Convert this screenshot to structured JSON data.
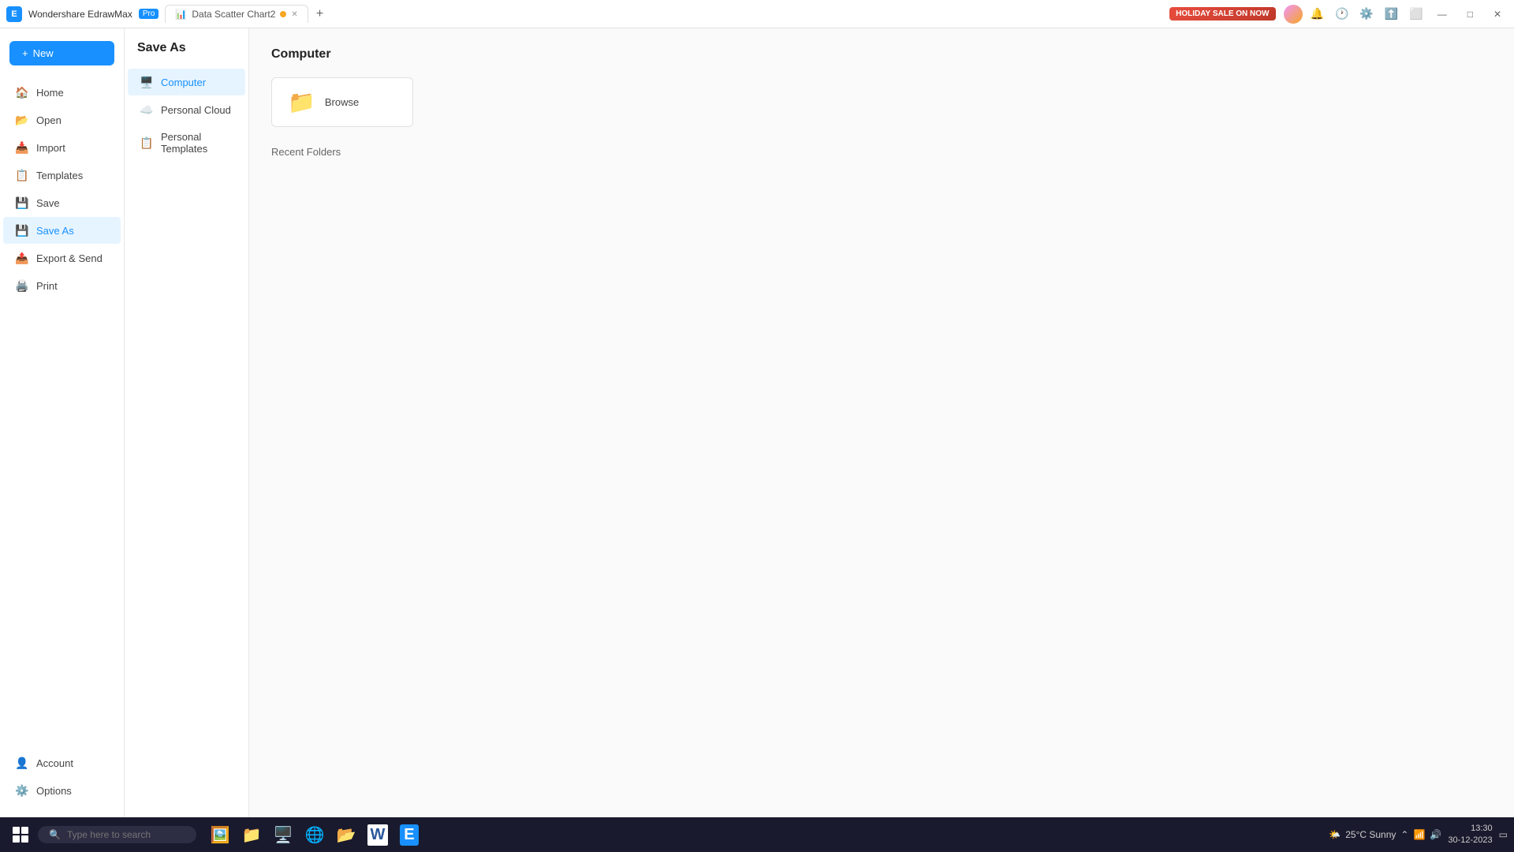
{
  "titlebar": {
    "app_name": "Wondershare EdrawMax",
    "pro_badge": "Pro",
    "tabs": [
      {
        "label": "Data Scatter Chart2",
        "active": false,
        "has_dot": true
      },
      {
        "label": "",
        "active": false
      }
    ],
    "holiday_btn": "HOLIDAY SALE ON NOW",
    "window_controls": {
      "minimize": "—",
      "maximize": "□",
      "close": "✕"
    }
  },
  "sidebar": {
    "new_btn": "New",
    "items": [
      {
        "id": "home",
        "label": "Home",
        "icon": "🏠"
      },
      {
        "id": "open",
        "label": "Open",
        "icon": "📂"
      },
      {
        "id": "import",
        "label": "Import",
        "icon": "📥"
      },
      {
        "id": "templates",
        "label": "Templates",
        "icon": "📋"
      },
      {
        "id": "save",
        "label": "Save",
        "icon": "💾"
      },
      {
        "id": "save-as",
        "label": "Save As",
        "icon": "💾",
        "active": true
      },
      {
        "id": "export-send",
        "label": "Export & Send",
        "icon": "📤"
      },
      {
        "id": "print",
        "label": "Print",
        "icon": "🖨️"
      }
    ],
    "bottom_items": [
      {
        "id": "account",
        "label": "Account",
        "icon": "👤"
      },
      {
        "id": "options",
        "label": "Options",
        "icon": "⚙️"
      }
    ]
  },
  "saveas_panel": {
    "title": "Save As",
    "items": [
      {
        "id": "computer",
        "label": "Computer",
        "icon": "🖥️",
        "active": true
      },
      {
        "id": "personal-cloud",
        "label": "Personal Cloud",
        "icon": "☁️"
      },
      {
        "id": "personal-templates",
        "label": "Personal Templates",
        "icon": "📋"
      }
    ]
  },
  "content": {
    "title": "Computer",
    "browse_label": "Browse",
    "recent_folders_label": "Recent Folders"
  },
  "taskbar": {
    "search_placeholder": "Type here to search",
    "apps": [
      "🗂️",
      "📁",
      "🖥️",
      "🌐",
      "📁",
      "W"
    ],
    "weather": "25°C  Sunny",
    "time": "13:30",
    "date": "30-12-2023"
  }
}
